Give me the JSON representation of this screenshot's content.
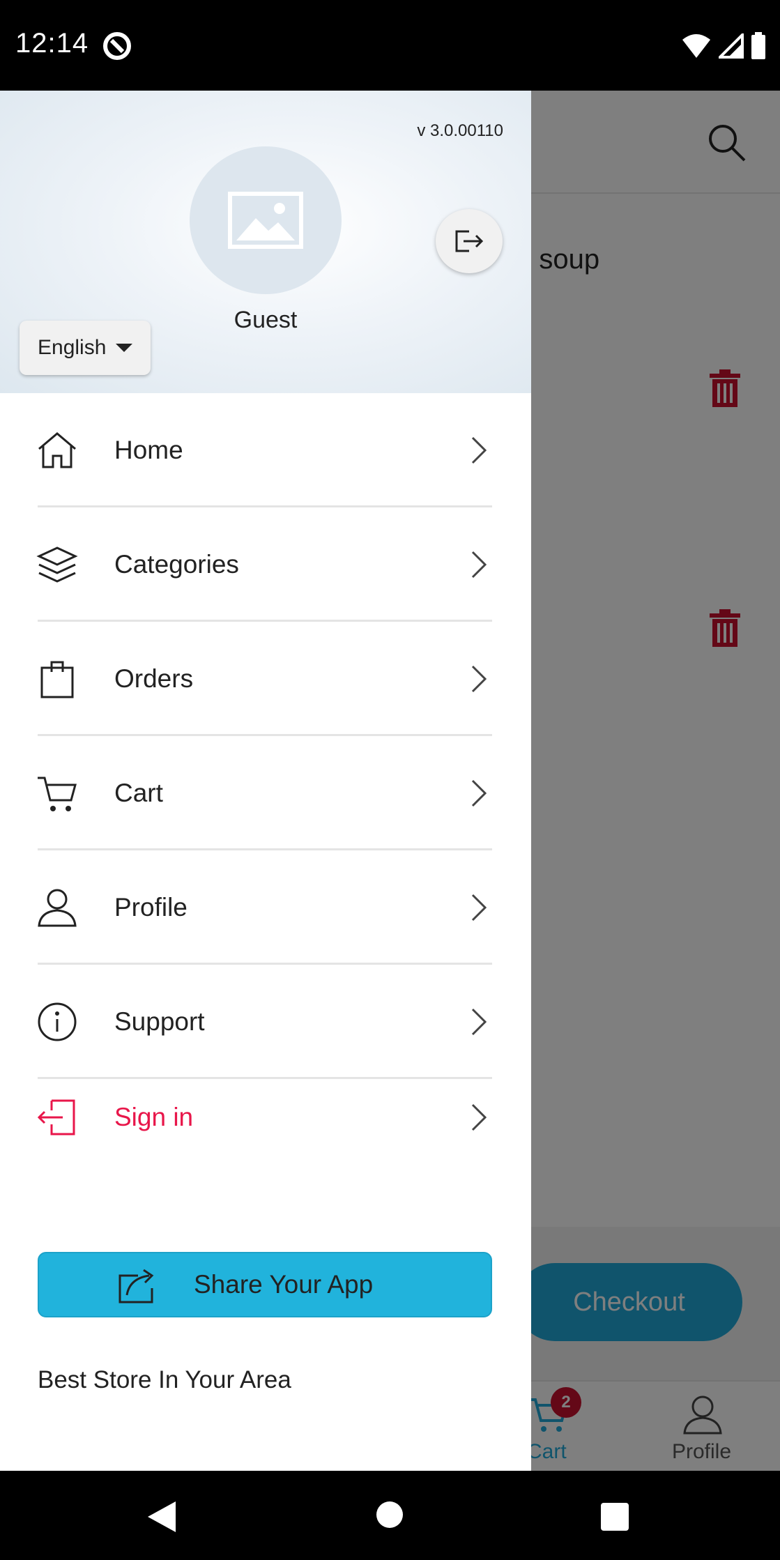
{
  "status_bar": {
    "time": "12:14"
  },
  "background_screen": {
    "product_text": "n soup",
    "checkout_label": "Checkout",
    "bottom_nav": {
      "cart_label": "Cart",
      "cart_badge": "2",
      "profile_label": "Profile"
    }
  },
  "drawer": {
    "version": "v 3.0.00110",
    "user_name": "Guest",
    "language": "English",
    "menu": [
      {
        "label": "Home",
        "icon": "home-icon"
      },
      {
        "label": "Categories",
        "icon": "layers-icon"
      },
      {
        "label": "Orders",
        "icon": "bag-icon"
      },
      {
        "label": "Cart",
        "icon": "cart-icon"
      },
      {
        "label": "Profile",
        "icon": "user-icon"
      },
      {
        "label": "Support",
        "icon": "info-icon"
      },
      {
        "label": "Sign in",
        "icon": "sign-in-icon"
      }
    ],
    "share_label": "Share Your App",
    "tagline": "Best Store In Your Area"
  },
  "colors": {
    "accent": "#21b3dc",
    "signin": "#e8164a",
    "badge": "#c8102e"
  }
}
